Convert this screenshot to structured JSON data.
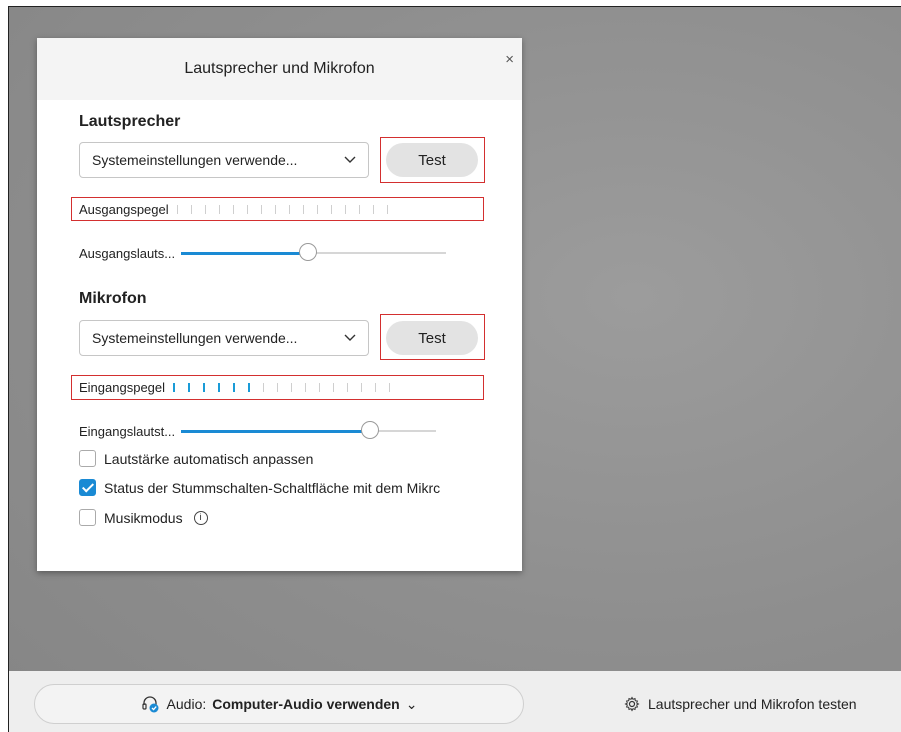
{
  "dialog": {
    "title": "Lautsprecher und Mikrofon",
    "close_glyph": "×",
    "speaker": {
      "heading": "Lautsprecher",
      "device": "Systemeinstellungen verwende...",
      "test_label": "Test",
      "level_label": "Ausgangspegel",
      "level_active_ticks": 0,
      "level_total_ticks": 16,
      "volume_label": "Ausgangslauts...",
      "volume_fraction": 0.48
    },
    "mic": {
      "heading": "Mikrofon",
      "device": "Systemeinstellungen verwende...",
      "test_label": "Test",
      "level_label": "Eingangspegel",
      "level_active_ticks": 6,
      "level_total_ticks": 16,
      "volume_label": "Eingangslautst...",
      "volume_fraction": 0.74
    },
    "options": [
      {
        "label": "Lautstärke automatisch anpassen",
        "checked": false
      },
      {
        "label": "Status der Stummschalten-Schaltfläche mit dem Mikrc",
        "checked": true
      },
      {
        "label": "Musikmodus",
        "checked": false
      }
    ]
  },
  "bottombar": {
    "audio_prefix": "Audio:",
    "audio_value": "Computer-Audio verwenden",
    "audio_chevron": "⌄",
    "test_link": "Lautsprecher und Mikrofon testen"
  },
  "colors": {
    "accent": "#1a8ad4",
    "highlight_box": "#d32f2f",
    "level_active": "#1a9bd7"
  },
  "icons": [
    "chevron-down-icon",
    "close-icon",
    "info-icon",
    "headset-icon",
    "gear-icon"
  ]
}
